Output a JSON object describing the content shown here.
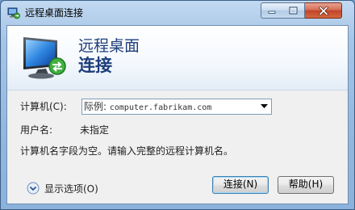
{
  "window": {
    "title": "远程桌面连接"
  },
  "banner": {
    "line1": "远程桌面",
    "line2": "连接"
  },
  "form": {
    "computer_label": "计算机(C):",
    "computer_placeholder_prefix": "际例:",
    "computer_placeholder_example": "computer.fabrikam.com",
    "username_label": "用户名:",
    "username_value": "未指定",
    "message": "计算机名字段为空。请输入完整的远程计算机名。"
  },
  "footer": {
    "options_label": "显示选项(O)",
    "connect_label": "连接(N)",
    "help_label": "帮助(H)"
  },
  "colors": {
    "title_blue": "#1d3d7a",
    "close_red": "#c2442a"
  }
}
